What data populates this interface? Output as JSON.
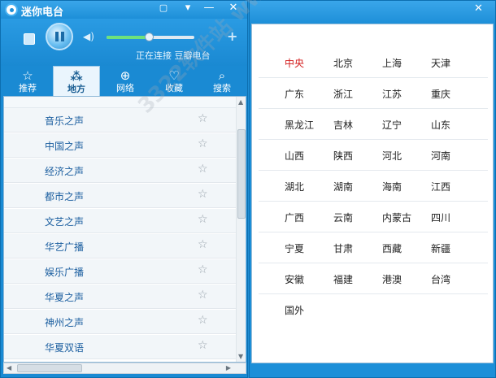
{
  "window": {
    "title": "迷你电台"
  },
  "player": {
    "status": "正在连接 豆瓣电台",
    "volume_percent": 48
  },
  "tabs": [
    {
      "label": "推荐",
      "icon": "star-outline-icon",
      "glyph": "☆"
    },
    {
      "label": "地方",
      "icon": "network-nodes-icon",
      "glyph": "⁂"
    },
    {
      "label": "网络",
      "icon": "globe-icon",
      "glyph": "⊕"
    },
    {
      "label": "收藏",
      "icon": "heart-plus-icon",
      "glyph": "♡"
    },
    {
      "label": "搜索",
      "icon": "search-icon",
      "glyph": "⌕"
    }
  ],
  "active_tab": 1,
  "stations": [
    "音乐之声",
    "中国之声",
    "经济之声",
    "都市之声",
    "文艺之声",
    "华艺广播",
    "娱乐广播",
    "华夏之声",
    "神州之声",
    "华夏双语"
  ],
  "regions": [
    [
      "中央",
      "北京",
      "上海",
      "天津"
    ],
    [
      "广东",
      "浙江",
      "江苏",
      "重庆"
    ],
    [
      "黑龙江",
      "吉林",
      "辽宁",
      "山东"
    ],
    [
      "山西",
      "陕西",
      "河北",
      "河南"
    ],
    [
      "湖北",
      "湖南",
      "海南",
      "江西"
    ],
    [
      "广西",
      "云南",
      "内蒙古",
      "四川"
    ],
    [
      "宁夏",
      "甘肃",
      "西藏",
      "新疆"
    ],
    [
      "安徽",
      "福建",
      "港澳",
      "台湾"
    ],
    [
      "国外"
    ]
  ],
  "selected_region": "中央",
  "watermark": "3322软件站 www.3322.cc",
  "colors": {
    "accent": "#1d8fd8",
    "selected_region": "#d31c1c",
    "station_text": "#1c5fa0"
  }
}
